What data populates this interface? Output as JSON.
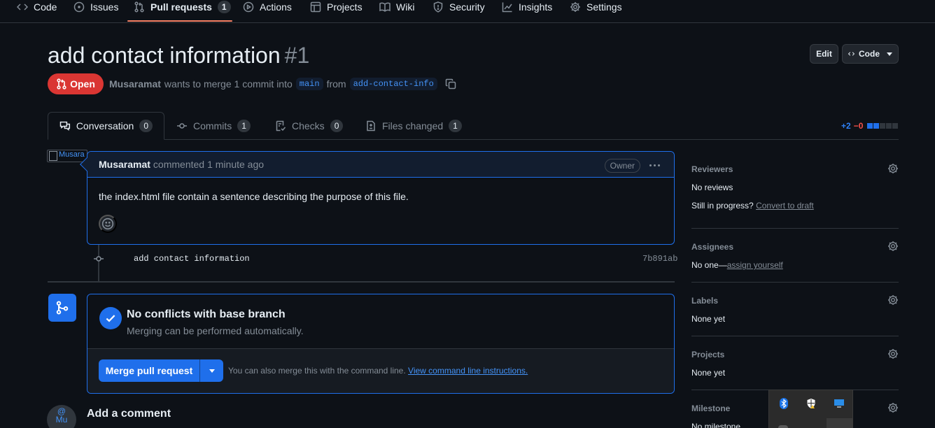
{
  "repo_nav": {
    "items": [
      {
        "label": "Code",
        "icon": "code-icon"
      },
      {
        "label": "Issues",
        "icon": "issue-icon"
      },
      {
        "label": "Pull requests",
        "icon": "pull-request-icon",
        "count": "1",
        "selected": true
      },
      {
        "label": "Actions",
        "icon": "play-icon"
      },
      {
        "label": "Projects",
        "icon": "table-icon"
      },
      {
        "label": "Wiki",
        "icon": "book-icon"
      },
      {
        "label": "Security",
        "icon": "shield-icon"
      },
      {
        "label": "Insights",
        "icon": "graph-icon"
      },
      {
        "label": "Settings",
        "icon": "gear-icon"
      }
    ]
  },
  "pr": {
    "title": "add contact information",
    "number": "#1",
    "state": "Open",
    "author": "Musaramat",
    "meta_text": "wants to merge 1 commit into",
    "base_branch": "main",
    "from_text": "from",
    "head_branch": "add-contact-info",
    "edit_label": "Edit",
    "code_label": "Code"
  },
  "tabs": [
    {
      "label": "Conversation",
      "count": "0",
      "icon": "comment-discussion-icon"
    },
    {
      "label": "Commits",
      "count": "1",
      "icon": "commit-icon"
    },
    {
      "label": "Checks",
      "count": "0",
      "icon": "checklist-icon"
    },
    {
      "label": "Files changed",
      "count": "1",
      "icon": "file-diff-icon"
    }
  ],
  "diffstat": {
    "additions": "+2",
    "deletions": "−0",
    "blocks_added": 2,
    "blocks_total": 5
  },
  "comment": {
    "avatar_alt": "Musara",
    "author": "Musaramat",
    "action": "commented",
    "time": "1 minute ago",
    "badge": "Owner",
    "body": "the index.html file contain a sentence describing the purpose of this file."
  },
  "commit": {
    "message": "add contact information",
    "sha": "7b891ab"
  },
  "merge": {
    "title": "No conflicts with base branch",
    "subtitle": "Merging can be performed automatically.",
    "button_label": "Merge pull request",
    "hint_text": "You can also merge this with the command line.",
    "hint_link": "View command line instructions."
  },
  "add_comment": {
    "avatar_alt_line1": "@",
    "avatar_alt_line2": "Mu",
    "title": "Add a comment"
  },
  "sidebar": {
    "reviewers": {
      "title": "Reviewers",
      "value": "No reviews",
      "progress_text": "Still in progress?",
      "progress_link": "Convert to draft"
    },
    "assignees": {
      "title": "Assignees",
      "value_prefix": "No one—",
      "value_link": "assign yourself"
    },
    "labels": {
      "title": "Labels",
      "value": "None yet"
    },
    "projects": {
      "title": "Projects",
      "value": "None yet"
    },
    "milestone": {
      "title": "Milestone",
      "value": "No milestone"
    }
  },
  "colors": {
    "accent": "#1f6feb",
    "open_state": "#da3633",
    "background": "#0d1117",
    "border": "#30363d",
    "muted_text": "#848d97",
    "underline": "#f78166"
  }
}
